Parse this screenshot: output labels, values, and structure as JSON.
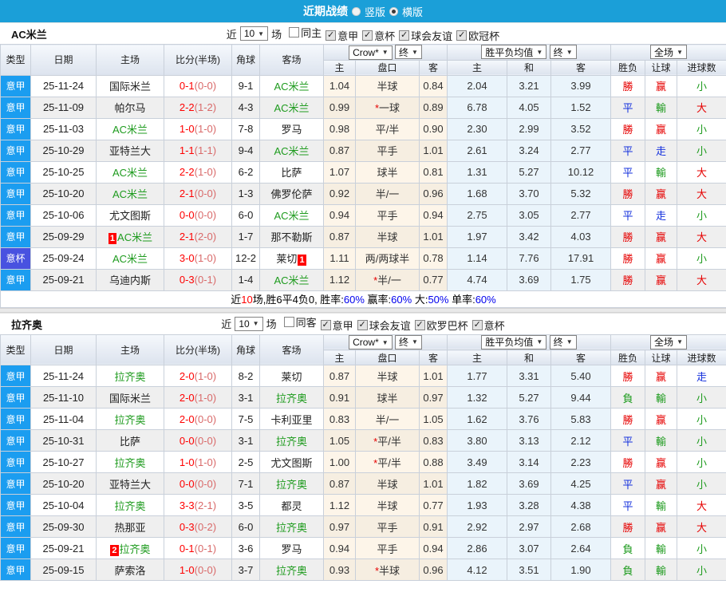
{
  "topbar": {
    "title": "近期战绩",
    "radios": [
      {
        "label": "竖版",
        "on": false
      },
      {
        "label": "横版",
        "on": true
      }
    ]
  },
  "headers": {
    "cols": [
      "类型",
      "日期",
      "主场",
      "比分(半场)",
      "角球",
      "客场"
    ],
    "subs": [
      "主",
      "盘口",
      "客",
      "主",
      "和",
      "客",
      "胜负",
      "让球",
      "进球数"
    ],
    "dd": {
      "crow": "Crow*",
      "final": "终",
      "avg": "胜平负均值",
      "full": "全场"
    }
  },
  "colors": {
    "topbar_blue": "#1b9fd8",
    "league_serie_a": "#1b9df0",
    "league_cup": "#4852e0",
    "team_highlight_green": "#1e9b1e",
    "score_red": "#ff0000",
    "result_red": "#e60000",
    "result_blue": "#1430dd",
    "result_green": "#1e9b1e",
    "odds_bg_cream": "#fdf5e9",
    "avg_bg_blue": "#eaf4fb"
  },
  "tables": [
    {
      "name": "AC米兰",
      "filter": {
        "near": "近",
        "count": "10",
        "unit": "场",
        "checks": [
          {
            "label": "同主",
            "checked": false
          },
          {
            "label": "意甲",
            "checked": true
          },
          {
            "label": "意杯",
            "checked": true
          },
          {
            "label": "球会友谊",
            "checked": true
          },
          {
            "label": "欧冠杯",
            "checked": true
          }
        ]
      },
      "rows": [
        {
          "lg": "意甲",
          "d": "25-11-24",
          "h": "国际米兰",
          "hg": false,
          "hb": "",
          "ft": "0-1",
          "ht": "(0-0)",
          "cn": "9-1",
          "a": "AC米兰",
          "ag": true,
          "ab": "",
          "o1": "1.04",
          "st": false,
          "ln": "半球",
          "o2": "0.84",
          "m1": "2.04",
          "m2": "3.21",
          "m3": "3.99",
          "r1": "勝",
          "r2": "赢",
          "r3": "小"
        },
        {
          "lg": "意甲",
          "d": "25-11-09",
          "h": "帕尔马",
          "hg": false,
          "hb": "",
          "ft": "2-2",
          "ht": "(1-2)",
          "cn": "4-3",
          "a": "AC米兰",
          "ag": true,
          "ab": "",
          "o1": "0.99",
          "st": true,
          "ln": "一球",
          "o2": "0.89",
          "m1": "6.78",
          "m2": "4.05",
          "m3": "1.52",
          "r1": "平",
          "r2": "輸",
          "r3": "大"
        },
        {
          "lg": "意甲",
          "d": "25-11-03",
          "h": "AC米兰",
          "hg": true,
          "hb": "",
          "ft": "1-0",
          "ht": "(1-0)",
          "cn": "7-8",
          "a": "罗马",
          "ag": false,
          "ab": "",
          "o1": "0.98",
          "st": false,
          "ln": "平/半",
          "o2": "0.90",
          "m1": "2.30",
          "m2": "2.99",
          "m3": "3.52",
          "r1": "勝",
          "r2": "赢",
          "r3": "小"
        },
        {
          "lg": "意甲",
          "d": "25-10-29",
          "h": "亚特兰大",
          "hg": false,
          "hb": "",
          "ft": "1-1",
          "ht": "(1-1)",
          "cn": "9-4",
          "a": "AC米兰",
          "ag": true,
          "ab": "",
          "o1": "0.87",
          "st": false,
          "ln": "平手",
          "o2": "1.01",
          "m1": "2.61",
          "m2": "3.24",
          "m3": "2.77",
          "r1": "平",
          "r2": "走",
          "r3": "小"
        },
        {
          "lg": "意甲",
          "d": "25-10-25",
          "h": "AC米兰",
          "hg": true,
          "hb": "",
          "ft": "2-2",
          "ht": "(1-0)",
          "cn": "6-2",
          "a": "比萨",
          "ag": false,
          "ab": "",
          "o1": "1.07",
          "st": false,
          "ln": "球半",
          "o2": "0.81",
          "m1": "1.31",
          "m2": "5.27",
          "m3": "10.12",
          "r1": "平",
          "r2": "輸",
          "r3": "大"
        },
        {
          "lg": "意甲",
          "d": "25-10-20",
          "h": "AC米兰",
          "hg": true,
          "hb": "",
          "ft": "2-1",
          "ht": "(0-0)",
          "cn": "1-3",
          "a": "佛罗伦萨",
          "ag": false,
          "ab": "",
          "o1": "0.92",
          "st": false,
          "ln": "半/一",
          "o2": "0.96",
          "m1": "1.68",
          "m2": "3.70",
          "m3": "5.32",
          "r1": "勝",
          "r2": "赢",
          "r3": "大"
        },
        {
          "lg": "意甲",
          "d": "25-10-06",
          "h": "尤文图斯",
          "hg": false,
          "hb": "",
          "ft": "0-0",
          "ht": "(0-0)",
          "cn": "6-0",
          "a": "AC米兰",
          "ag": true,
          "ab": "",
          "o1": "0.94",
          "st": false,
          "ln": "平手",
          "o2": "0.94",
          "m1": "2.75",
          "m2": "3.05",
          "m3": "2.77",
          "r1": "平",
          "r2": "走",
          "r3": "小"
        },
        {
          "lg": "意甲",
          "d": "25-09-29",
          "h": "AC米兰",
          "hg": true,
          "hb": "1",
          "ft": "2-1",
          "ht": "(2-0)",
          "cn": "1-7",
          "a": "那不勒斯",
          "ag": false,
          "ab": "",
          "o1": "0.87",
          "st": false,
          "ln": "半球",
          "o2": "1.01",
          "m1": "1.97",
          "m2": "3.42",
          "m3": "4.03",
          "r1": "勝",
          "r2": "赢",
          "r3": "大"
        },
        {
          "lg": "意杯",
          "d": "25-09-24",
          "h": "AC米兰",
          "hg": true,
          "hb": "",
          "ft": "3-0",
          "ht": "(1-0)",
          "cn": "12-2",
          "a": "莱切",
          "ag": false,
          "ab": "1",
          "o1": "1.11",
          "st": false,
          "ln": "两/两球半",
          "o2": "0.78",
          "m1": "1.14",
          "m2": "7.76",
          "m3": "17.91",
          "r1": "勝",
          "r2": "赢",
          "r3": "小"
        },
        {
          "lg": "意甲",
          "d": "25-09-21",
          "h": "乌迪内斯",
          "hg": false,
          "hb": "",
          "ft": "0-3",
          "ht": "(0-1)",
          "cn": "1-4",
          "a": "AC米兰",
          "ag": true,
          "ab": "",
          "o1": "1.12",
          "st": true,
          "ln": "半/一",
          "o2": "0.77",
          "m1": "4.74",
          "m2": "3.69",
          "m3": "1.75",
          "r1": "勝",
          "r2": "赢",
          "r3": "大"
        }
      ],
      "summary": [
        {
          "t": "近",
          "c": "k"
        },
        {
          "t": "10",
          "c": "r"
        },
        {
          "t": "场,胜6平4负0, 胜率:",
          "c": "k"
        },
        {
          "t": "60%",
          "c": "b"
        },
        {
          "t": " 赢率:",
          "c": "k"
        },
        {
          "t": "60%",
          "c": "b"
        },
        {
          "t": " 大:",
          "c": "k"
        },
        {
          "t": "50%",
          "c": "b"
        },
        {
          "t": " 单率:",
          "c": "k"
        },
        {
          "t": "60%",
          "c": "b"
        }
      ]
    },
    {
      "name": "拉齐奥",
      "filter": {
        "near": "近",
        "count": "10",
        "unit": "场",
        "checks": [
          {
            "label": "同客",
            "checked": false
          },
          {
            "label": "意甲",
            "checked": true
          },
          {
            "label": "球会友谊",
            "checked": true
          },
          {
            "label": "欧罗巴杯",
            "checked": true
          },
          {
            "label": "意杯",
            "checked": true
          }
        ]
      },
      "rows": [
        {
          "lg": "意甲",
          "d": "25-11-24",
          "h": "拉齐奥",
          "hg": true,
          "hb": "",
          "ft": "2-0",
          "ht": "(1-0)",
          "cn": "8-2",
          "a": "莱切",
          "ag": false,
          "ab": "",
          "o1": "0.87",
          "st": false,
          "ln": "半球",
          "o2": "1.01",
          "m1": "1.77",
          "m2": "3.31",
          "m3": "5.40",
          "r1": "勝",
          "r2": "赢",
          "r3": "走"
        },
        {
          "lg": "意甲",
          "d": "25-11-10",
          "h": "国际米兰",
          "hg": false,
          "hb": "",
          "ft": "2-0",
          "ht": "(1-0)",
          "cn": "3-1",
          "a": "拉齐奥",
          "ag": true,
          "ab": "",
          "o1": "0.91",
          "st": false,
          "ln": "球半",
          "o2": "0.97",
          "m1": "1.32",
          "m2": "5.27",
          "m3": "9.44",
          "r1": "負",
          "r2": "輸",
          "r3": "小"
        },
        {
          "lg": "意甲",
          "d": "25-11-04",
          "h": "拉齐奥",
          "hg": true,
          "hb": "",
          "ft": "2-0",
          "ht": "(0-0)",
          "cn": "7-5",
          "a": "卡利亚里",
          "ag": false,
          "ab": "",
          "o1": "0.83",
          "st": false,
          "ln": "半/一",
          "o2": "1.05",
          "m1": "1.62",
          "m2": "3.76",
          "m3": "5.83",
          "r1": "勝",
          "r2": "赢",
          "r3": "小"
        },
        {
          "lg": "意甲",
          "d": "25-10-31",
          "h": "比萨",
          "hg": false,
          "hb": "",
          "ft": "0-0",
          "ht": "(0-0)",
          "cn": "3-1",
          "a": "拉齐奥",
          "ag": true,
          "ab": "",
          "o1": "1.05",
          "st": true,
          "ln": "平/半",
          "o2": "0.83",
          "m1": "3.80",
          "m2": "3.13",
          "m3": "2.12",
          "r1": "平",
          "r2": "輸",
          "r3": "小"
        },
        {
          "lg": "意甲",
          "d": "25-10-27",
          "h": "拉齐奥",
          "hg": true,
          "hb": "",
          "ft": "1-0",
          "ht": "(1-0)",
          "cn": "2-5",
          "a": "尤文图斯",
          "ag": false,
          "ab": "",
          "o1": "1.00",
          "st": true,
          "ln": "平/半",
          "o2": "0.88",
          "m1": "3.49",
          "m2": "3.14",
          "m3": "2.23",
          "r1": "勝",
          "r2": "赢",
          "r3": "小"
        },
        {
          "lg": "意甲",
          "d": "25-10-20",
          "h": "亚特兰大",
          "hg": false,
          "hb": "",
          "ft": "0-0",
          "ht": "(0-0)",
          "cn": "7-1",
          "a": "拉齐奥",
          "ag": true,
          "ab": "",
          "o1": "0.87",
          "st": false,
          "ln": "半球",
          "o2": "1.01",
          "m1": "1.82",
          "m2": "3.69",
          "m3": "4.25",
          "r1": "平",
          "r2": "赢",
          "r3": "小"
        },
        {
          "lg": "意甲",
          "d": "25-10-04",
          "h": "拉齐奥",
          "hg": true,
          "hb": "",
          "ft": "3-3",
          "ht": "(2-1)",
          "cn": "3-5",
          "a": "都灵",
          "ag": false,
          "ab": "",
          "o1": "1.12",
          "st": false,
          "ln": "半球",
          "o2": "0.77",
          "m1": "1.93",
          "m2": "3.28",
          "m3": "4.38",
          "r1": "平",
          "r2": "輸",
          "r3": "大"
        },
        {
          "lg": "意甲",
          "d": "25-09-30",
          "h": "热那亚",
          "hg": false,
          "hb": "",
          "ft": "0-3",
          "ht": "(0-2)",
          "cn": "6-0",
          "a": "拉齐奥",
          "ag": true,
          "ab": "",
          "o1": "0.97",
          "st": false,
          "ln": "平手",
          "o2": "0.91",
          "m1": "2.92",
          "m2": "2.97",
          "m3": "2.68",
          "r1": "勝",
          "r2": "赢",
          "r3": "大"
        },
        {
          "lg": "意甲",
          "d": "25-09-21",
          "h": "拉齐奥",
          "hg": true,
          "hb": "2",
          "ft": "0-1",
          "ht": "(0-1)",
          "cn": "3-6",
          "a": "罗马",
          "ag": false,
          "ab": "",
          "o1": "0.94",
          "st": false,
          "ln": "平手",
          "o2": "0.94",
          "m1": "2.86",
          "m2": "3.07",
          "m3": "2.64",
          "r1": "負",
          "r2": "輸",
          "r3": "小"
        },
        {
          "lg": "意甲",
          "d": "25-09-15",
          "h": "萨索洛",
          "hg": false,
          "hb": "",
          "ft": "1-0",
          "ht": "(0-0)",
          "cn": "3-7",
          "a": "拉齐奥",
          "ag": true,
          "ab": "",
          "o1": "0.93",
          "st": true,
          "ln": "半球",
          "o2": "0.96",
          "m1": "4.12",
          "m2": "3.51",
          "m3": "1.90",
          "r1": "負",
          "r2": "輸",
          "r3": "小"
        }
      ],
      "summary": null
    }
  ]
}
